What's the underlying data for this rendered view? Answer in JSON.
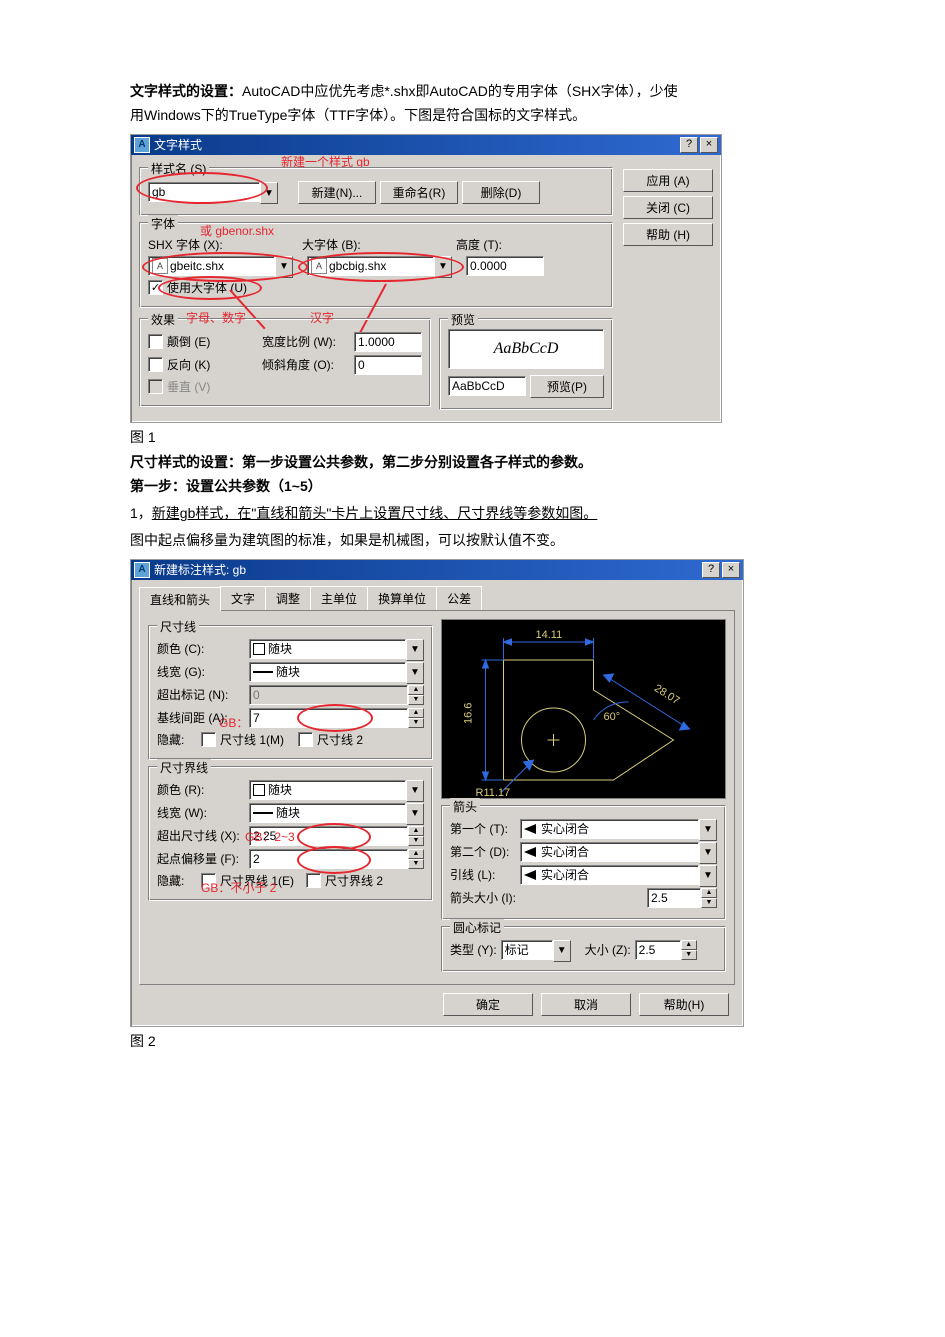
{
  "intro": {
    "bold_label": "文字样式的设置：",
    "line1_rest": "AutoCAD中应优先考虑*.shx即AutoCAD的专用字体（SHX字体），少使",
    "line2": "用Windows下的TrueType字体（TTF字体）。下图是符合国标的文字样式。"
  },
  "dlg1": {
    "title": "文字样式",
    "anno_new_style": "新建一个样式 gb",
    "group_style_name": "样式名 (S)",
    "style_value": "gb",
    "btn_new": "新建(N)...",
    "btn_rename": "重命名(R)",
    "btn_delete": "删除(D)",
    "btn_apply": "应用 (A)",
    "btn_close": "关闭 (C)",
    "btn_help": "帮助 (H)",
    "group_font": "字体",
    "anno_or_gbenor": "或 gbenor.shx",
    "shx_label": "SHX 字体 (X):",
    "shx_value": "gbeitc.shx",
    "bigfont_label": "大字体 (B):",
    "bigfont_value": "gbcbig.shx",
    "height_label": "高度 (T):",
    "height_value": "0.0000",
    "use_bigfont": "使用大字体 (U)",
    "anno_letters": "字母、数字",
    "anno_hanzi": "汉字",
    "group_effect": "效果",
    "chk_upside": "颠倒 (E)",
    "chk_backward": "反向 (K)",
    "chk_vert": "垂直 (V)",
    "width_label": "宽度比例 (W):",
    "width_value": "1.0000",
    "oblique_label": "倾斜角度 (O):",
    "oblique_value": "0",
    "group_preview": "预览",
    "preview_sample": "AaBbCcD",
    "preview_input": "AaBbCcD",
    "btn_preview": "预览(P)"
  },
  "fig1_caption": "图 1",
  "mid_text": {
    "line_a": "尺寸样式的设置：第一步设置公共参数，第二步分别设置各子样式的参数。",
    "line_b": "第一步：设置公共参数（1~5）",
    "line_c_pre": "1，",
    "line_c_link": "新建gb样式，在\"直线和箭头\"卡片上设置尺寸线、尺寸界线等参数如图。",
    "line_d": "图中起点偏移量为建筑图的标准，如果是机械图，可以按默认值不变。"
  },
  "dlg2": {
    "title": "新建标注样式: gb",
    "tabs": [
      "直线和箭头",
      "文字",
      "调整",
      "主单位",
      "换算单位",
      "公差"
    ],
    "grp_dimline": "尺寸线",
    "color_label": "颜色 (C):",
    "color_value": "随块",
    "lw_label": "线宽 (G):",
    "lw_value": "随块",
    "exttick_label": "超出标记 (N):",
    "exttick_value": "0",
    "baseline_label": "基线间距 (A):",
    "baseline_value": "7",
    "anno_gb_7_10": "GB：7~10mm",
    "hide_label": "隐藏:",
    "hide_dl1": "尺寸线 1(M)",
    "hide_dl2": "尺寸线 2",
    "grp_extline": "尺寸界线",
    "ext_color_label": "颜色 (R):",
    "ext_lw_label": "线宽 (W):",
    "ext_lw_value": "随块",
    "ext_beyond_label": "超出尺寸线 (X):",
    "ext_beyond_value": "2.25",
    "anno_gb_2_3": "GB：2~3",
    "ext_offset_label": "起点偏移量 (F):",
    "ext_offset_value": "2",
    "anno_gb_ge2": "GB：不小于 2",
    "hide_el1": "尺寸界线 1(E)",
    "hide_el2": "尺寸界线 2",
    "grp_arrow": "箭头",
    "arrow1_label": "第一个 (T):",
    "arrow2_label": "第二个 (D):",
    "leader_label": "引线 (L):",
    "arrow_value": "实心闭合",
    "arrow_size_label": "箭头大小 (I):",
    "arrow_size_value": "2.5",
    "grp_center": "圆心标记",
    "center_type_label": "类型 (Y):",
    "center_type_value": "标记",
    "center_size_label": "大小 (Z):",
    "center_size_value": "2.5",
    "btn_ok": "确定",
    "btn_cancel": "取消",
    "btn_help": "帮助(H)",
    "preview_dim_top": "14.11",
    "preview_dim_left": "16.6",
    "preview_dim_diag": "28.07",
    "preview_dim_angle": "60°",
    "preview_dim_radius": "R11.17"
  },
  "fig2_caption": "图 2"
}
